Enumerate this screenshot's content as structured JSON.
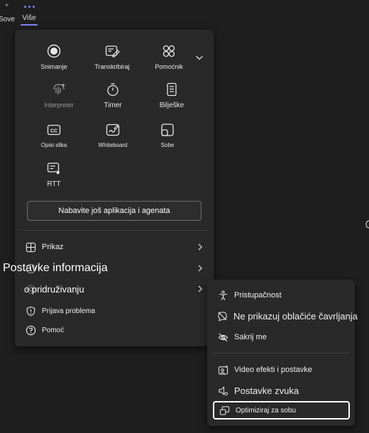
{
  "topbar": {
    "sove_label": "Sove",
    "vise_label": "Više"
  },
  "grid": [
    {
      "label": "Snimanje",
      "icon": "record-icon"
    },
    {
      "label": "Transkribiraj",
      "icon": "transcribe-icon"
    },
    {
      "label": "Pomoćnik",
      "icon": "apps-icon"
    },
    {
      "label": "Interpreter",
      "icon": "interpreter-icon",
      "disabled": true
    },
    {
      "label": "Timer",
      "icon": "timer-icon"
    },
    {
      "label": "Bilješke",
      "icon": "notes-icon"
    },
    {
      "label": "Opisi slika",
      "icon": "captions-icon"
    },
    {
      "label": "Whiteboard",
      "icon": "whiteboard-icon"
    },
    {
      "label": "Sobe",
      "icon": "rooms-icon"
    },
    {
      "label": "RTT",
      "icon": "rtt-icon"
    }
  ],
  "more_apps_label": "Nabavite još aplikacija i agenata",
  "list": {
    "prikaz": "Prikaz",
    "settings_line1": "Postavke informacija",
    "settings_line2": "o pridruživanju",
    "report": "Prijava problema",
    "help": "Pomoć"
  },
  "submenu": {
    "accessibility": "Pristupačnost",
    "no_bubbles": "Ne prikazuj oblačiće čavrljanja",
    "hide_me": "Sakrij me",
    "video_effects": "Video efekti i postavke",
    "audio_settings": "Postavke zvuka",
    "optimize_room": "Optimiziraj za sobu"
  },
  "colors": {
    "background": "#1f1f1f",
    "menu": "#292929",
    "accent": "#7f85f5"
  }
}
